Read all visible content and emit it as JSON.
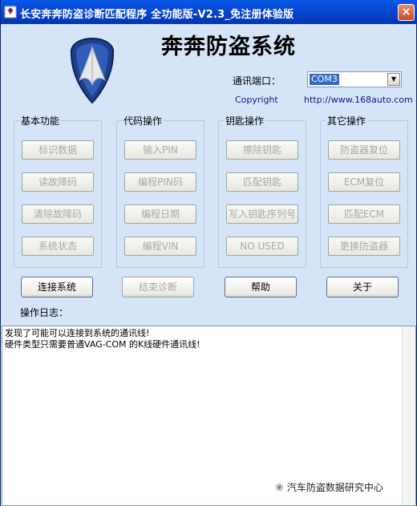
{
  "window": {
    "title": "长安奔奔防盗诊断匹配程序 全功能版-V2.3_免注册体验版",
    "close_label": "×"
  },
  "header": {
    "app_title": "奔奔防盗系统",
    "port_label": "通讯端口：",
    "port_value": "COM3",
    "copyright": "Copyright",
    "url": "http://www.168auto.com"
  },
  "groups": [
    {
      "label": "基本功能",
      "buttons": [
        "标识数据",
        "读故障码",
        "清除故障码",
        "系统状态"
      ]
    },
    {
      "label": "代码操作",
      "buttons": [
        "输入PIN",
        "编程PIN码",
        "编程日期",
        "编程VIN"
      ]
    },
    {
      "label": "钥匙操作",
      "buttons": [
        "擦除钥匙",
        "匹配钥匙",
        "写入钥匙序列号",
        "NO USED"
      ]
    },
    {
      "label": "其它操作",
      "buttons": [
        "防盗器复位",
        "ECM复位",
        "匹配ECM",
        "更换防盗器"
      ]
    }
  ],
  "actions": {
    "connect": "连接系统",
    "end_diag": "结束诊断",
    "help": "帮助",
    "about": "关于"
  },
  "log": {
    "label": "操作日志：",
    "lines": [
      "发现了可能可以连接到系统的通讯线!",
      "硬件类型只需要普通VAG-COM 的K线硬件通讯线!"
    ]
  },
  "watermark": "汽车防盗数据研究中心",
  "colors": {
    "titlebar": "#0541c8",
    "window_bg": "#d6e4f8",
    "link": "#0b1a8c",
    "selection": "#316ac5",
    "disabled_text": "#a8a8a8"
  }
}
